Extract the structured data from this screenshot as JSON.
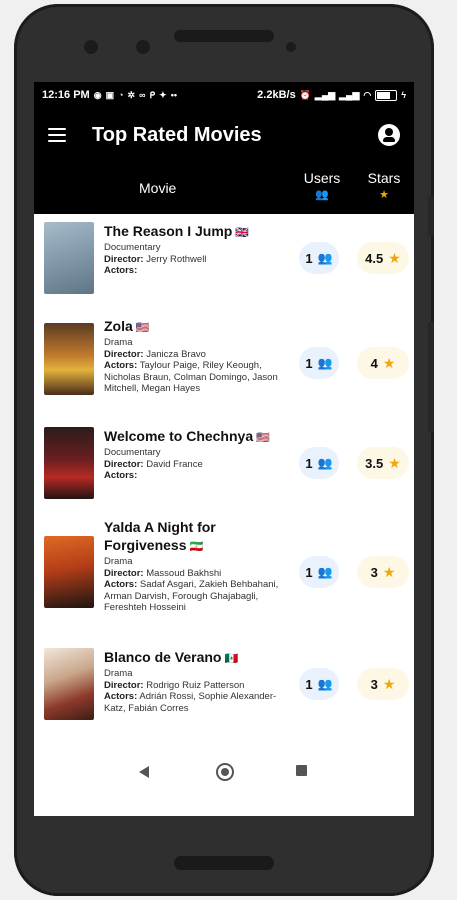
{
  "status_bar": {
    "time": "12:16 PM",
    "speed": "2.2kB/s",
    "left_icons": [
      "whatsapp-icon",
      "image-icon",
      "rss-icon",
      "settings-icon",
      "link-icon",
      "pinterest-icon",
      "twitter-icon",
      "more-icon"
    ],
    "right_icons": [
      "alarm-icon",
      "signal-icon",
      "signal-icon",
      "wifi-icon",
      "battery-icon",
      "charging-icon"
    ]
  },
  "app_bar": {
    "title": "Top Rated Movies",
    "menu_icon": "menu-icon",
    "account_icon": "account-circle-icon"
  },
  "columns": {
    "movie": "Movie",
    "users": "Users",
    "stars": "Stars",
    "users_icon": "group-icon",
    "stars_icon": "star-icon",
    "users_icon_color": "#4a8ae0",
    "stars_icon_color": "#f2a60b"
  },
  "movies": [
    {
      "title": "The Reason I Jump",
      "flag": "🇬🇧",
      "genre": "Documentary",
      "director_label": "Director:",
      "director": "Jerry Rothwell",
      "actors_label": "Actors:",
      "actors": "",
      "users": "1",
      "stars": "4.5"
    },
    {
      "title": "Zola",
      "flag": "🇺🇸",
      "genre": "Drama",
      "director_label": "Director:",
      "director": "Janicza Bravo",
      "actors_label": "Actors:",
      "actors": "Taylour Paige, Riley Keough, Nicholas Braun, Colman Domingo, Jason Mitchell, Megan Hayes",
      "users": "1",
      "stars": "4"
    },
    {
      "title": "Welcome to Chechnya",
      "flag": "🇺🇸",
      "genre": "Documentary",
      "director_label": "Director:",
      "director": "David France",
      "actors_label": "Actors:",
      "actors": "",
      "users": "1",
      "stars": "3.5"
    },
    {
      "title": "Yalda A Night for Forgiveness",
      "flag": "🇮🇷",
      "genre": "Drama",
      "director_label": "Director:",
      "director": "Massoud Bakhshi",
      "actors_label": "Actors:",
      "actors": "Sadaf Asgari, Zakieh Behbahani, Arman Darvish, Forough Ghajabagli, Fereshteh Hosseini",
      "users": "1",
      "stars": "3"
    },
    {
      "title": "Blanco de Verano",
      "flag": "🇲🇽",
      "genre": "Drama",
      "director_label": "Director:",
      "director": "Rodrigo Ruiz Patterson",
      "actors_label": "Actors:",
      "actors": "Adrián Rossi, Sophie Alexander-Katz, Fabián Corres",
      "users": "1",
      "stars": "3"
    }
  ],
  "nav_bar": {
    "back_icon": "back-triangle-icon",
    "home_icon": "home-circle-icon",
    "recents_icon": "recents-square-icon"
  },
  "colors": {
    "app_bar_bg": "#000000",
    "content_bg": "#ffffff",
    "users_accent": "#1f6fd6",
    "users_pill_bg": "#e9f2fc",
    "stars_accent": "#f2a60b",
    "stars_pill_bg": "#fdf7e6"
  }
}
